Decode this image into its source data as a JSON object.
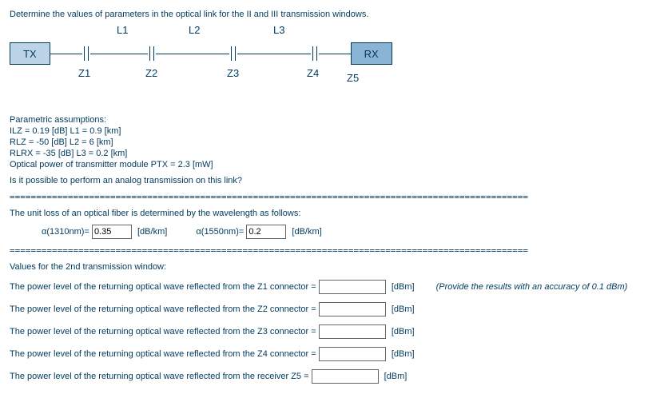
{
  "intro": "Determine the values of parameters in the optical link for the II and III transmission windows.",
  "diagram": {
    "tx": "TX",
    "rx": "RX",
    "l1": "L1",
    "l2": "L2",
    "l3": "L3",
    "z1": "Z1",
    "z2": "Z2",
    "z3": "Z3",
    "z4": "Z4",
    "z5": "Z5"
  },
  "assumptions": {
    "heading": "Parametric assumptions:",
    "line1": "ILZ = 0.19 [dB]   L1 = 0.9 [km]",
    "line2": "RLZ = -50 [dB]    L2 = 6 [km]",
    "line3": "RLRX = -35 [dB]   L3 = 0.2 [km]",
    "line4": "Optical power of transmitter module PTX = 2.3 [mW]"
  },
  "question_analog": "Is it possible to perform an analog transmission on this link?",
  "separator": "==================================================================================================",
  "fiber_loss_intro": "The unit loss of an optical fiber is determined by the wavelength as follows:",
  "alpha": {
    "a1310_label": "α(1310nm)=",
    "a1310_val": "0.35",
    "a1550_label": "α(1550nm)=",
    "a1550_val": "0.2",
    "unit": "[dB/km]"
  },
  "window2_heading": "Values for the 2nd transmission window:",
  "qs": {
    "z1": "The power level of the returning optical wave reflected from the Z1 connector =",
    "z2": "The power level of the returning optical wave reflected from the Z2 connector =",
    "z3": "The power level of the returning optical wave reflected from the Z3 connector =",
    "z4": "The power level of the returning optical wave reflected from the Z4 connector =",
    "z5": "The power level of the returning optical wave reflected from the receiver Z5 ="
  },
  "dbm": "[dBm]",
  "accuracy_note": "(Provide the results with an accuracy of 0.1 dBm)"
}
